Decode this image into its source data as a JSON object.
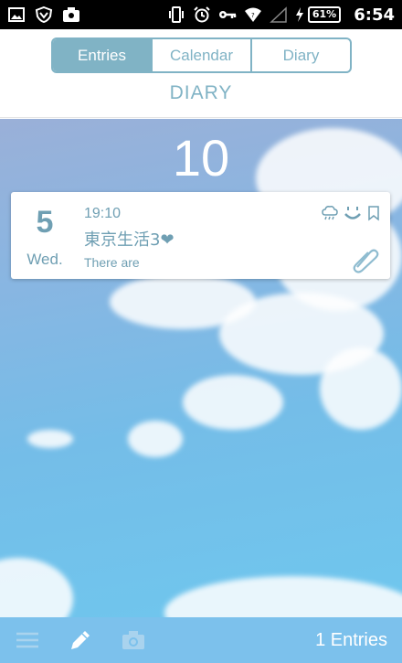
{
  "status_bar": {
    "battery": "61%",
    "time": "6:54"
  },
  "tabs": [
    {
      "label": "Entries",
      "active": true
    },
    {
      "label": "Calendar",
      "active": false
    },
    {
      "label": "Diary",
      "active": false
    }
  ],
  "header": {
    "title": "DIARY"
  },
  "month": "10",
  "entry": {
    "day": "5",
    "weekday": "Wed.",
    "time": "19:10",
    "title": "東京生活3",
    "title_suffix": "❤",
    "body": "There are"
  },
  "bottom_bar": {
    "count_label": "1 Entries"
  },
  "colors": {
    "accent": "#80b3c5",
    "text": "#6f9fb3",
    "bottom_bar": "#7cc1ec"
  },
  "icons": [
    "menu-icon",
    "pencil-icon",
    "camera-icon",
    "weather-icon",
    "smile-icon",
    "bookmark-icon",
    "paperclip-icon"
  ]
}
